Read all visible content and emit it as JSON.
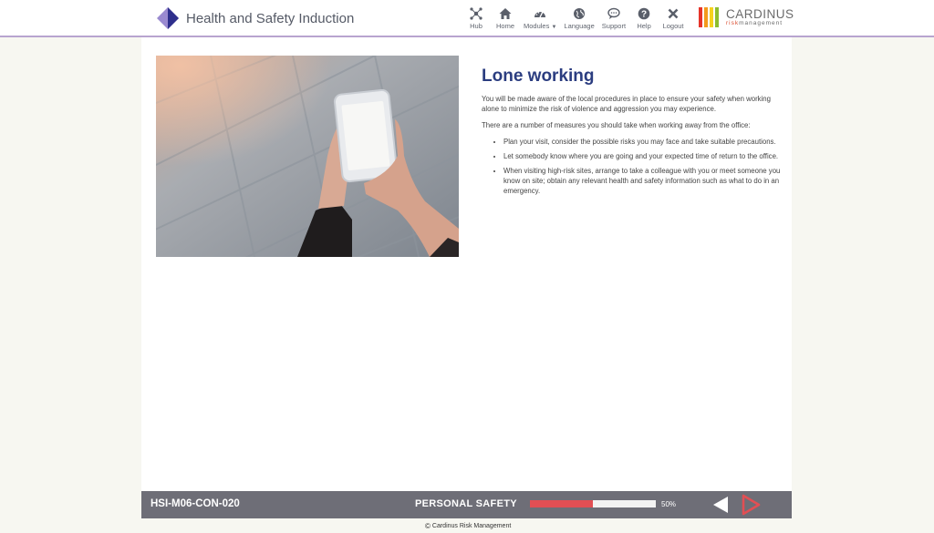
{
  "header": {
    "app_title": "Health and Safety Induction",
    "nav": [
      {
        "label": "Hub",
        "icon": "hub-icon"
      },
      {
        "label": "Home",
        "icon": "home-icon"
      },
      {
        "label": "Modules",
        "icon": "dashboard-icon"
      },
      {
        "label": "Language",
        "icon": "globe-icon"
      },
      {
        "label": "Support",
        "icon": "chat-icon"
      },
      {
        "label": "Help",
        "icon": "question-icon"
      },
      {
        "label": "Logout",
        "icon": "close-icon"
      }
    ],
    "brand_name": "CARDINUS",
    "brand_sub_risk": "risk",
    "brand_sub_management": "management"
  },
  "content": {
    "heading": "Lone working",
    "paragraph1": "You will be made aware of the local procedures in place to ensure your safety when working alone to minimize the risk of violence and aggression you may experience.",
    "paragraph2": "There are a number of measures you should take when working away from the office:",
    "bullets": [
      "Plan your visit, consider the possible risks you may face and take suitable precautions.",
      "Let somebody know where you are going and your expected time of return to the office.",
      "When visiting high-risk sites, arrange to take a colleague with you or meet someone you know on site; obtain any relevant health and safety information such as what to do in an emergency."
    ],
    "image_icon": "hands-holding-phone-photo"
  },
  "footer": {
    "course_code": "HSI-M06-CON-020",
    "section": "PERSONAL SAFETY",
    "progress_percent": 50,
    "progress_label": "50%",
    "copyright": "Cardinus Risk Management"
  },
  "colors": {
    "heading": "#2b3d80",
    "footer_bg": "#6e6e77",
    "progress_fill": "#e24f54",
    "header_border": "#b8a4cf",
    "next_arrow": "#e24f54"
  }
}
